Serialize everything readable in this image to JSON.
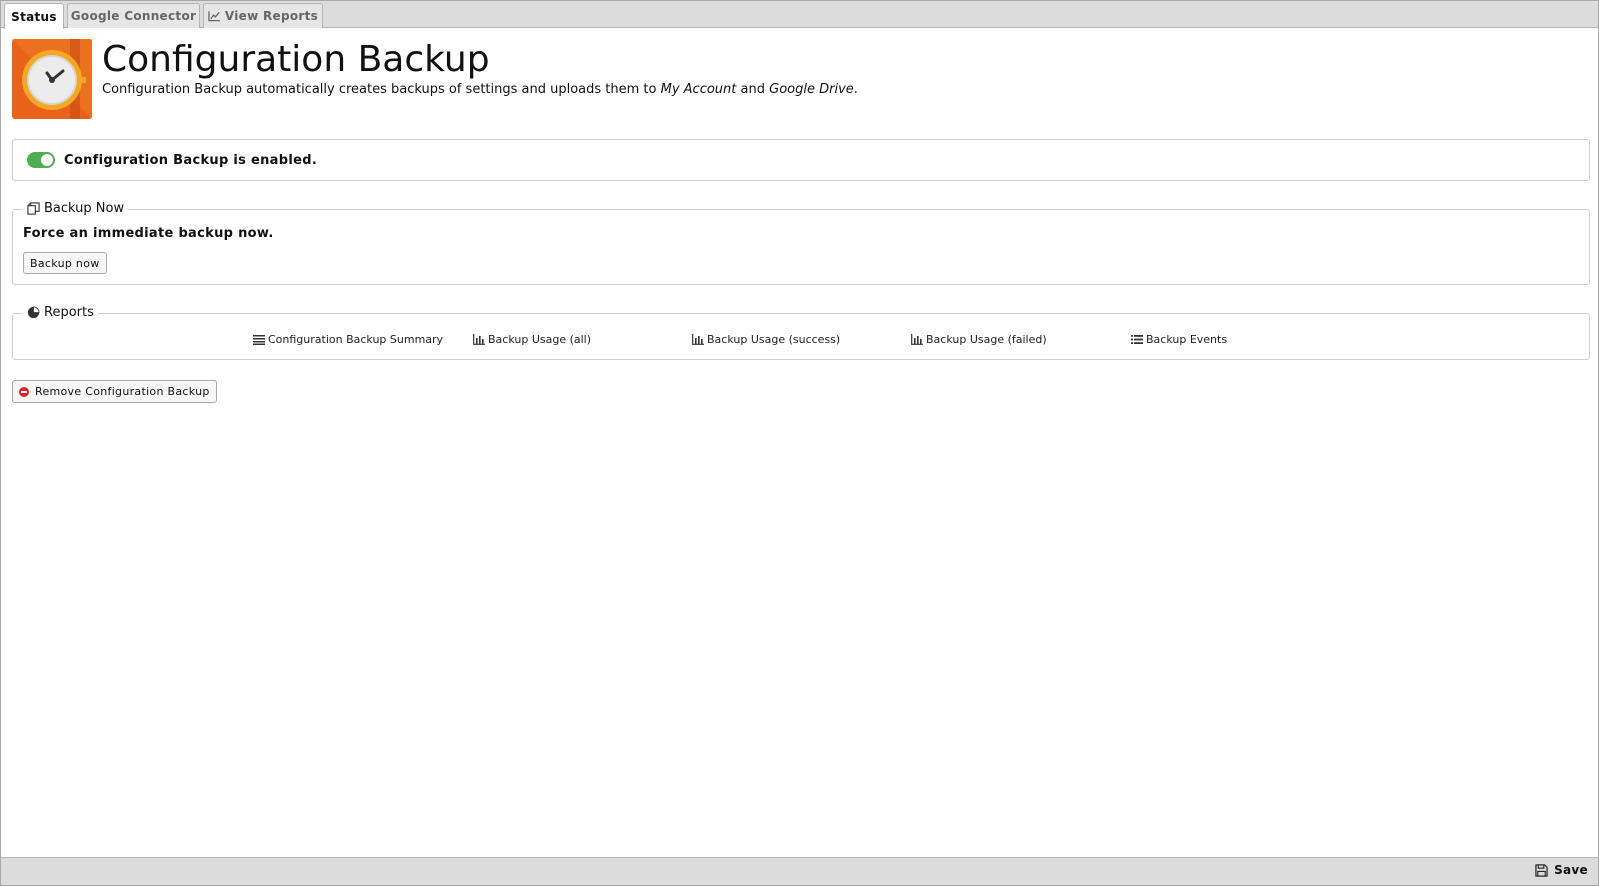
{
  "tabs": [
    {
      "label": "Status",
      "active": true
    },
    {
      "label": "Google Connector",
      "active": false
    },
    {
      "label": "View Reports",
      "active": false,
      "icon": "line-chart-icon"
    }
  ],
  "header": {
    "title": "Configuration Backup",
    "subtitle_prefix": "Configuration Backup automatically creates backups of settings and uploads them to ",
    "subtitle_em1": "My Account",
    "subtitle_mid": " and ",
    "subtitle_em2": "Google Drive",
    "subtitle_suffix": "."
  },
  "status": {
    "enabled": true,
    "text": "Configuration Backup is enabled."
  },
  "backup_now": {
    "legend": "Backup Now",
    "description": "Force an immediate backup now.",
    "button_label": "Backup now"
  },
  "reports": {
    "legend": "Reports",
    "links": [
      {
        "label": "Configuration Backup Summary",
        "icon": "list-lines-icon"
      },
      {
        "label": "Backup Usage (all)",
        "icon": "bar-chart-icon"
      },
      {
        "label": "Backup Usage (success)",
        "icon": "bar-chart-icon"
      },
      {
        "label": "Backup Usage (failed)",
        "icon": "bar-chart-icon"
      },
      {
        "label": "Backup Events",
        "icon": "bullet-list-icon"
      }
    ]
  },
  "remove_button_label": "Remove Configuration Backup",
  "footer": {
    "save_label": "Save"
  },
  "colors": {
    "toggle_on": "#4caf50",
    "remove_icon": "#e02020",
    "app_icon_orange": "#e8621a"
  }
}
